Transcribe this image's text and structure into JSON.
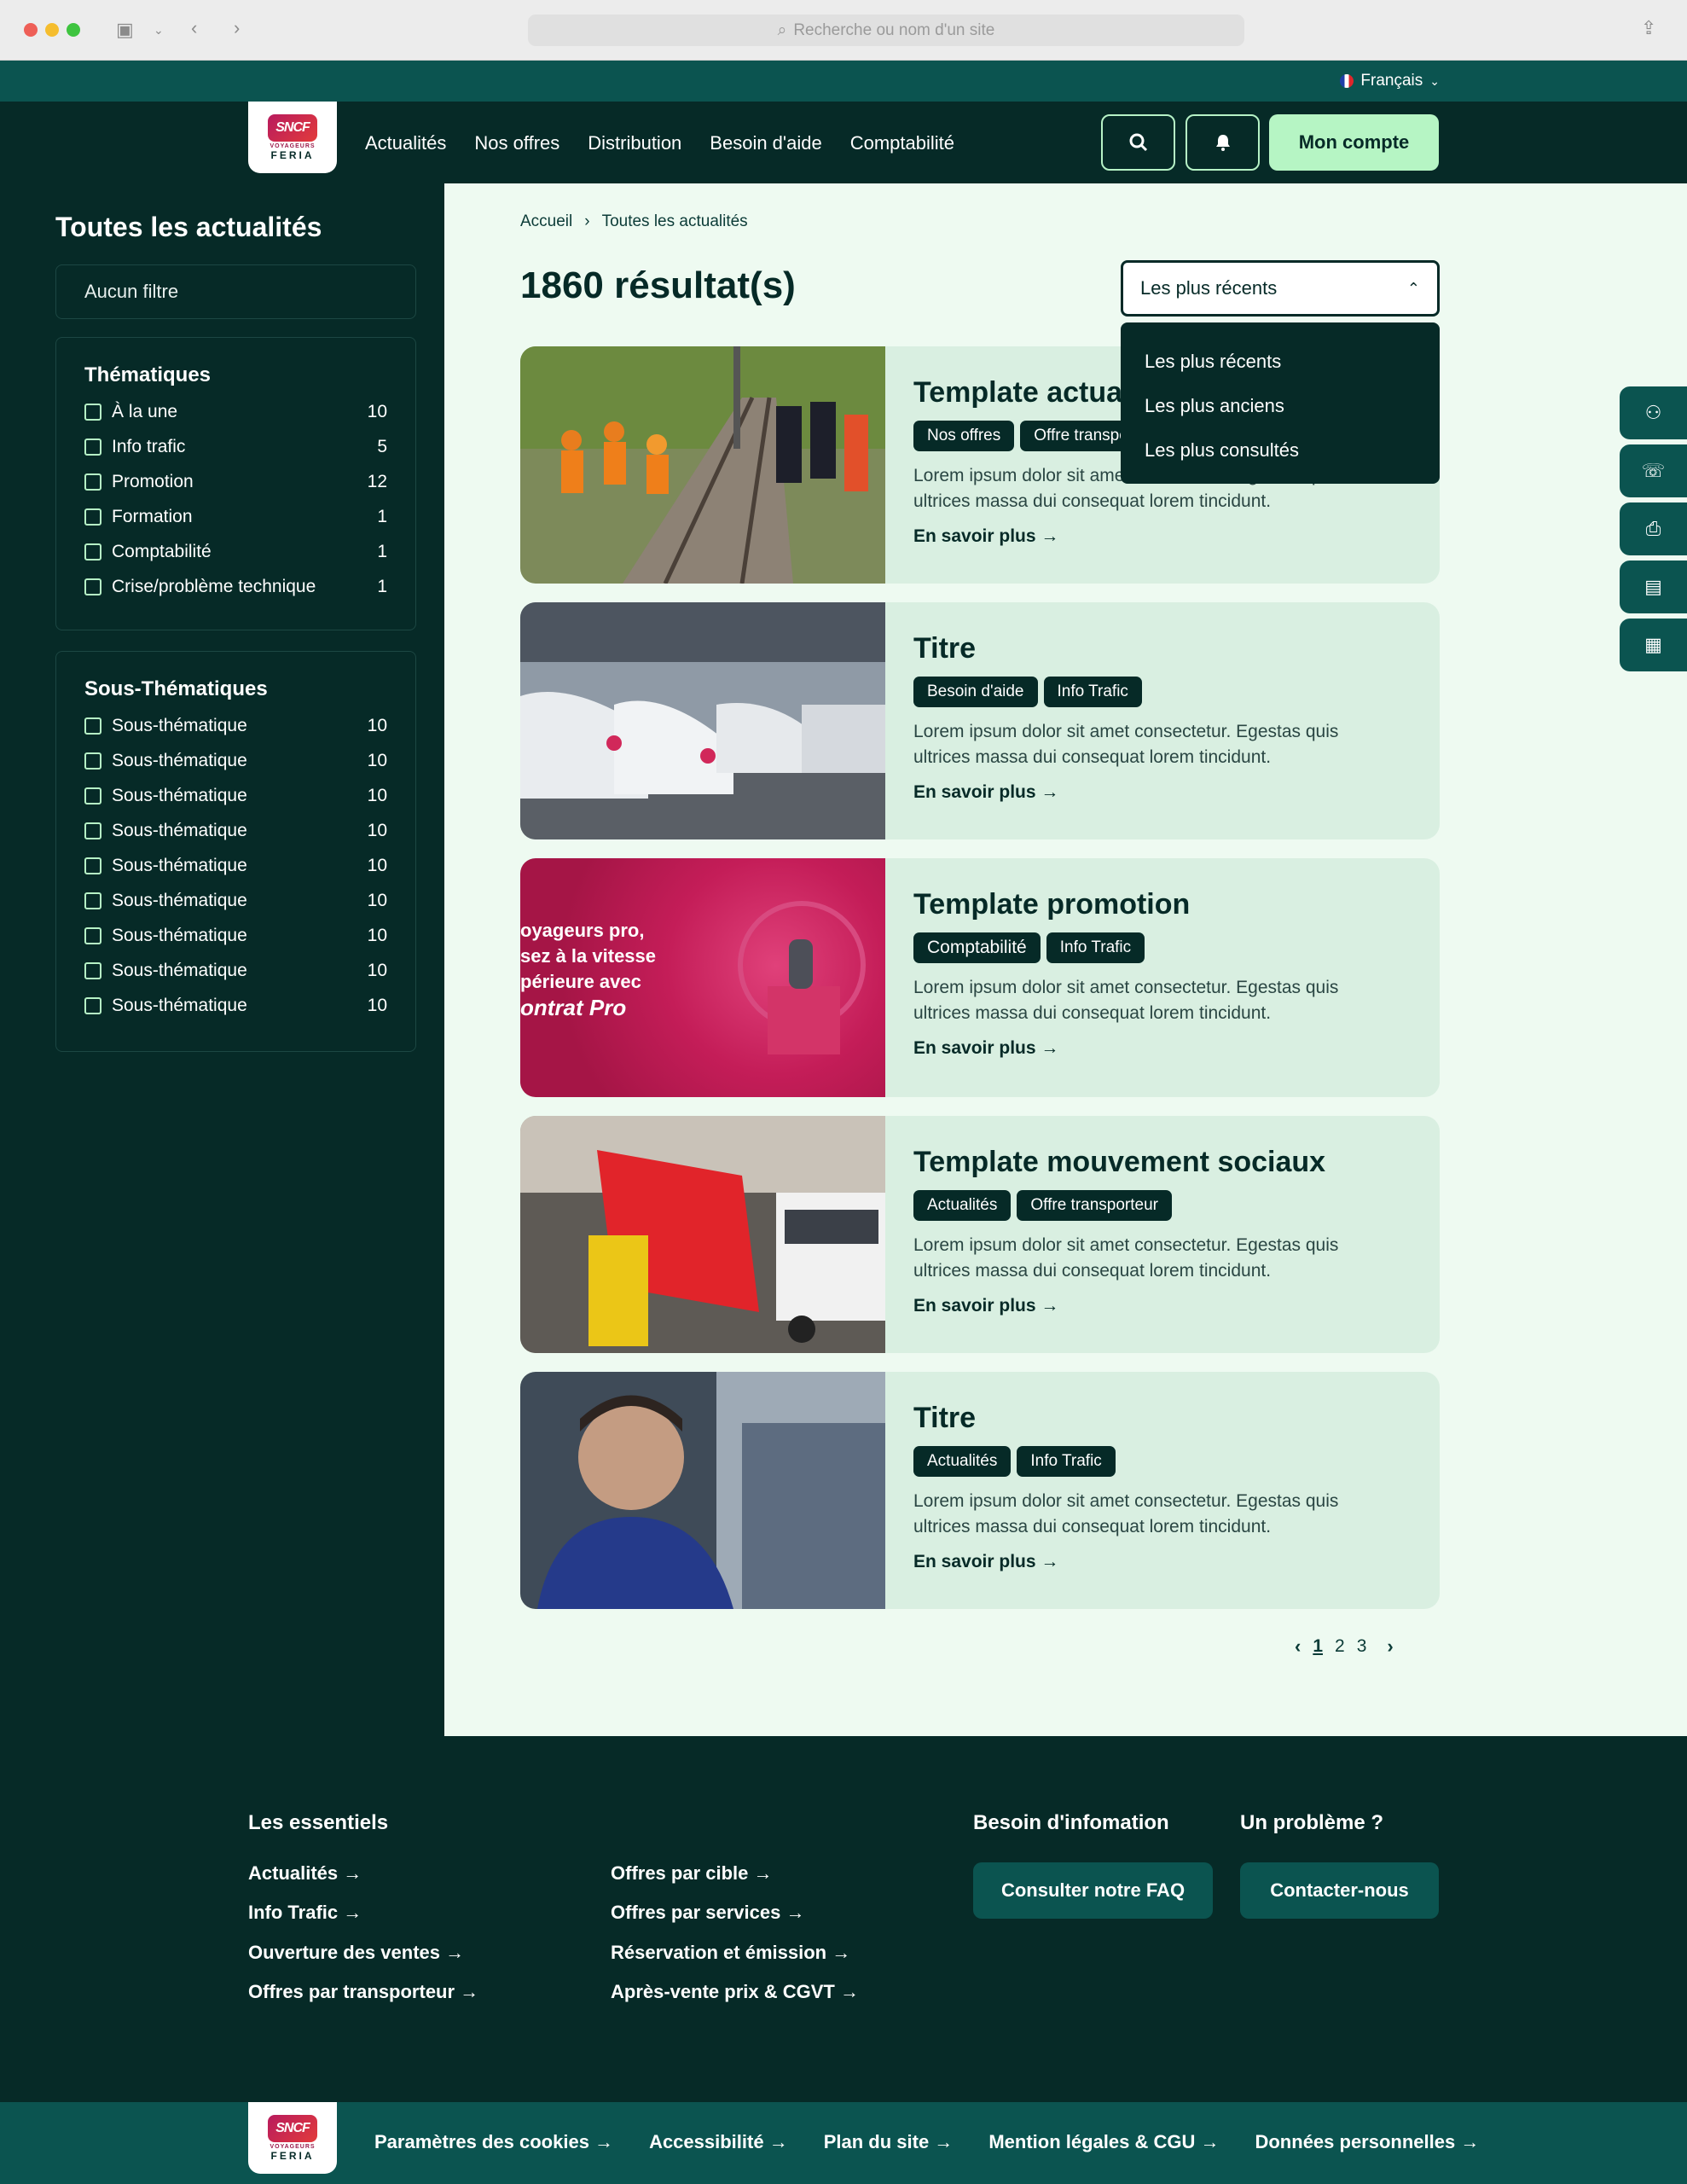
{
  "browser": {
    "address_placeholder": "Recherche ou nom d'un site"
  },
  "header": {
    "language": "Français",
    "logo": {
      "brand": "SNCF",
      "line1": "VOYAGEURS",
      "line2": "FERIA"
    },
    "nav": [
      "Actualités",
      "Nos offres",
      "Distribution",
      "Besoin d'aide",
      "Comptabilité"
    ],
    "account_label": "Mon compte"
  },
  "sidebar": {
    "title": "Toutes les actualités",
    "no_filter": "Aucun filtre",
    "themes": {
      "title": "Thématiques",
      "items": [
        {
          "label": "À la une",
          "count": "10"
        },
        {
          "label": "Info trafic",
          "count": "5"
        },
        {
          "label": "Promotion",
          "count": "12"
        },
        {
          "label": "Formation",
          "count": "1"
        },
        {
          "label": "Comptabilité",
          "count": "1"
        },
        {
          "label": "Crise/problème technique",
          "count": "1"
        }
      ]
    },
    "subthemes": {
      "title": "Sous-Thématiques",
      "items": [
        {
          "label": "Sous-thématique",
          "count": "10"
        },
        {
          "label": "Sous-thématique",
          "count": "10"
        },
        {
          "label": "Sous-thématique",
          "count": "10"
        },
        {
          "label": "Sous-thématique",
          "count": "10"
        },
        {
          "label": "Sous-thématique",
          "count": "10"
        },
        {
          "label": "Sous-thématique",
          "count": "10"
        },
        {
          "label": "Sous-thématique",
          "count": "10"
        },
        {
          "label": "Sous-thématique",
          "count": "10"
        },
        {
          "label": "Sous-thématique",
          "count": "10"
        }
      ]
    }
  },
  "main": {
    "breadcrumb": [
      "Accueil",
      "Toutes les actualités"
    ],
    "results": "1860 résultat(s)",
    "sort": {
      "selected": "Les plus récents",
      "options": [
        "Les plus récents",
        "Les plus anciens",
        "Les plus consultés"
      ]
    },
    "cards": [
      {
        "title": "Template actualité",
        "tags": [
          "Nos offres",
          "Offre transporteur"
        ],
        "desc": "Lorem ipsum dolor sit amet consectetur. Egestas quis ultrices massa dui consequat lorem tincidunt.",
        "more": "En savoir plus"
      },
      {
        "title": "Titre",
        "tags": [
          "Besoin d'aide",
          "Info Trafic"
        ],
        "desc": "Lorem ipsum dolor sit amet consectetur. Egestas quis ultrices massa dui consequat lorem tincidunt.",
        "more": "En savoir plus"
      },
      {
        "title": "Template promotion",
        "tags": [
          "Comptabilité",
          "Info Trafic"
        ],
        "desc": "Lorem ipsum dolor sit amet consectetur. Egestas quis ultrices massa dui consequat lorem tincidunt.",
        "more": "En savoir plus",
        "promo_text": [
          "oyageurs pro,",
          "sez à la vitesse",
          "périeure avec",
          "ontrat Pro"
        ]
      },
      {
        "title": "Template mouvement sociaux",
        "tags": [
          "Actualités",
          "Offre transporteur"
        ],
        "desc": "Lorem ipsum dolor sit amet consectetur. Egestas quis ultrices massa dui consequat lorem tincidunt.",
        "more": "En savoir plus"
      },
      {
        "title": "Titre",
        "tags": [
          "Actualités",
          "Info Trafic"
        ],
        "desc": "Lorem ipsum dolor sit amet consectetur. Egestas quis ultrices massa dui consequat lorem tincidunt.",
        "more": "En savoir plus"
      }
    ],
    "pagination": {
      "pages": [
        "1",
        "2",
        "3"
      ],
      "current": "1",
      "prev": "‹",
      "next": "›"
    }
  },
  "footer": {
    "essentials_title": "Les essentiels",
    "col1": [
      "Actualités",
      "Info Trafic",
      "Ouverture des ventes",
      "Offres par transporteur"
    ],
    "col2": [
      "Offres par cible",
      "Offres par services",
      "Réservation et émission",
      "Après-vente prix & CGVT"
    ],
    "info_title": "Besoin d'infomation",
    "faq_button": "Consulter notre FAQ",
    "problem_title": "Un problème ?",
    "contact_button": "Contacter-nous",
    "bottom_links": [
      "Paramètres des cookies",
      "Accessibilité",
      "Plan du site",
      "Mention légales & CGU",
      "Données personnelles"
    ]
  },
  "colors": {
    "dark": "#062a27",
    "teal": "#0b5450",
    "mint": "#b6f5c4",
    "light_bg": "#eefaf1",
    "card_bg": "#d9efe1"
  }
}
